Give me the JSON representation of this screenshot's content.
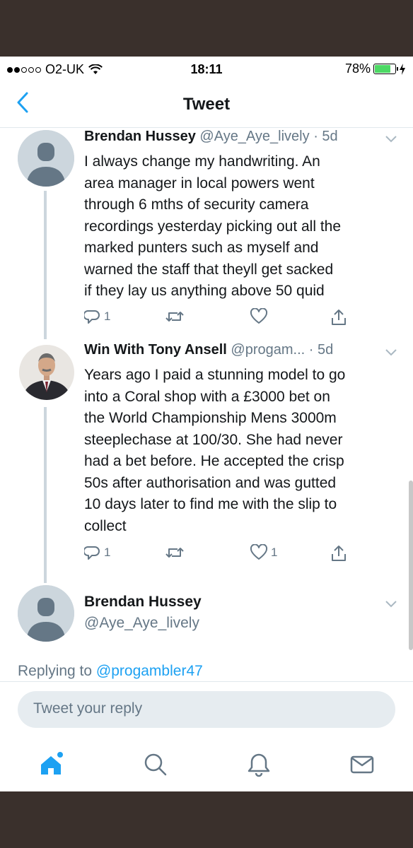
{
  "status_bar": {
    "carrier": "O2-UK",
    "time": "18:11",
    "battery": "78%",
    "battery_level": 0.78
  },
  "nav": {
    "title": "Tweet",
    "back_icon": "chevron-left-icon"
  },
  "tweets": [
    {
      "name": "Brendan Hussey",
      "handle": "@Aye_Aye_lively",
      "time": "· 5d",
      "lines": [
        "I always change my handwriting. An",
        "area manager in local powers went",
        "through 6 mths of security camera",
        "recordings yesterday picking out all the",
        "marked punters such as myself and",
        "warned the staff that theyll get sacked",
        "if they lay us anything above 50 quid"
      ],
      "replies": "1",
      "retweets": "",
      "likes": ""
    },
    {
      "name": "Win With Tony Ansell",
      "handle": "@progam...",
      "time": "· 5d",
      "lines": [
        "Years ago I paid a stunning model to go",
        "into a Coral shop with a £3000 bet on",
        "the World Championship Mens 3000m",
        "steeplechase at 100/30. She had never",
        "had a bet before. He accepted the crisp",
        "50s after authorisation and was gutted",
        "10 days later to find me with the slip to",
        "collect"
      ],
      "replies": "1",
      "retweets": "",
      "likes": "1"
    }
  ],
  "composer_user": {
    "name": "Brendan Hussey",
    "handle": "@Aye_Aye_lively"
  },
  "reply": {
    "prefix": "Replying to",
    "mention": "@progambler47",
    "placeholder": "Tweet your reply"
  },
  "tabbar": [
    "home-icon",
    "search-icon",
    "notifications-icon",
    "messages-icon"
  ],
  "colors": {
    "accent": "#1da1f2",
    "muted": "#657786",
    "text": "#14171a",
    "avatar_placeholder": "#ccd6dd",
    "battery_fill": "#4cd964"
  }
}
